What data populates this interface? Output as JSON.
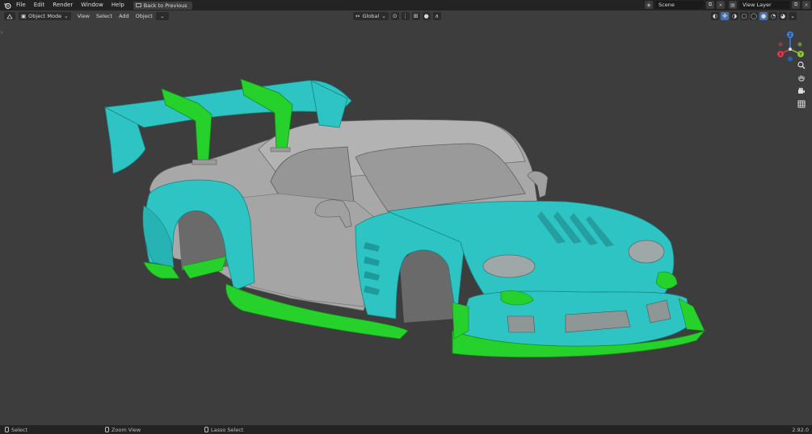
{
  "topbar": {
    "menus": [
      "File",
      "Edit",
      "Render",
      "Window",
      "Help"
    ],
    "back_button": "Back to Previous",
    "scene_label": "Scene",
    "view_layer_label": "View Layer"
  },
  "viewport_header": {
    "mode": "Object Mode",
    "menus": [
      "View",
      "Select",
      "Add",
      "Object"
    ],
    "transform_orientation": "Global"
  },
  "gizmo": {
    "x_label": "X",
    "y_label": "Y",
    "z_label": "Z",
    "colors": {
      "x": "#e0384f",
      "y": "#8bc933",
      "z": "#3b7fe3"
    }
  },
  "navigation_icons": [
    "zoom-icon",
    "hand-pan-icon",
    "camera-icon",
    "grid-ortho-icon"
  ],
  "statusbar": {
    "select": "Select",
    "zoom_view": "Zoom View",
    "lasso_select": "Lasso Select",
    "version": "2.92.0"
  },
  "colors": {
    "viewport_bg": "#3d3d3d",
    "body_cyan": "#2fc6c6",
    "accent_green": "#26d12b",
    "body_grey": "#a9a9a9"
  }
}
